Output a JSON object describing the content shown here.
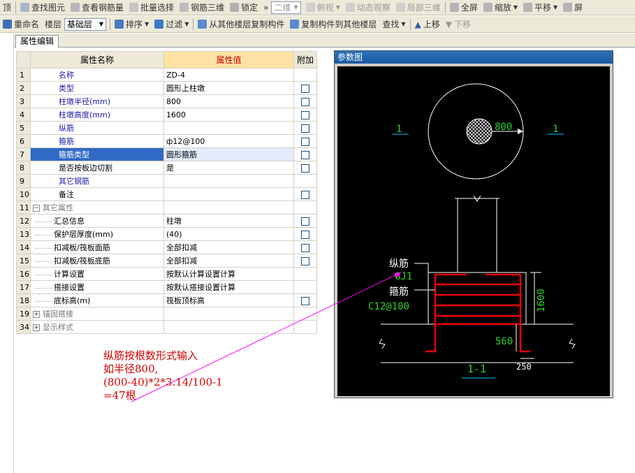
{
  "toolbar1": {
    "items": [
      "顶",
      "查找图元",
      "查看钢筋量",
      "批量选择",
      "钢筋三维",
      "锁定"
    ],
    "overflow": "»",
    "view_mode": "二维",
    "items2": [
      "俯视",
      "动态观察",
      "局部三维",
      "全屏",
      "缩放",
      "平移",
      "屏"
    ]
  },
  "toolbar2": {
    "rename": "重命名",
    "floor_label": "楼层",
    "floor_value": "基础层",
    "sort": "排序",
    "filter": "过滤",
    "copy_from": "从其他楼层复制构件",
    "copy_to": "复制构件到其他楼层",
    "find": "查找",
    "move_up": "上移",
    "move_down": "下移"
  },
  "tab": "属性编辑",
  "grid": {
    "headers": {
      "name": "属性名称",
      "value": "属性值",
      "extra": "附加"
    },
    "rows": [
      {
        "num": "1",
        "name": "名称",
        "value": "ZD-4",
        "blue": true,
        "cb": false,
        "tree": "",
        "indent": false
      },
      {
        "num": "2",
        "name": "类型",
        "value": "圆形上柱墩",
        "blue": true,
        "cb": true,
        "tree": "",
        "indent": false
      },
      {
        "num": "3",
        "name": "柱墩半径(mm)",
        "value": "800",
        "blue": true,
        "cb": true,
        "tree": "",
        "indent": false
      },
      {
        "num": "4",
        "name": "柱墩高度(mm)",
        "value": "1600",
        "blue": true,
        "cb": true,
        "tree": "",
        "indent": false
      },
      {
        "num": "5",
        "name": "纵筋",
        "value": "",
        "blue": true,
        "cb": true,
        "tree": "",
        "indent": false
      },
      {
        "num": "6",
        "name": "箍筋",
        "value": "ф12@100",
        "blue": true,
        "cb": true,
        "tree": "",
        "indent": false
      },
      {
        "num": "7",
        "name": "箍筋类型",
        "value": "圆形箍筋",
        "blue": true,
        "cb": true,
        "tree": "",
        "indent": false,
        "selected": true
      },
      {
        "num": "8",
        "name": "是否按板边切割",
        "value": "是",
        "blue": false,
        "cb": true,
        "tree": "",
        "indent": false
      },
      {
        "num": "9",
        "name": "其它钢筋",
        "value": "",
        "blue": true,
        "cb": false,
        "tree": "",
        "indent": false
      },
      {
        "num": "10",
        "name": "备注",
        "value": "",
        "blue": false,
        "cb": true,
        "tree": "",
        "indent": false
      },
      {
        "num": "11",
        "name": "其它属性",
        "value": "",
        "blue": false,
        "cb": false,
        "tree": "−",
        "indent": false,
        "group": true
      },
      {
        "num": "12",
        "name": "汇总信息",
        "value": "柱墩",
        "blue": false,
        "cb": true,
        "tree": "",
        "indent": true
      },
      {
        "num": "13",
        "name": "保护层厚度(mm)",
        "value": "(40)",
        "blue": false,
        "cb": true,
        "tree": "",
        "indent": true
      },
      {
        "num": "14",
        "name": "扣减板/筏板面筋",
        "value": "全部扣减",
        "blue": false,
        "cb": true,
        "tree": "",
        "indent": true
      },
      {
        "num": "15",
        "name": "扣减板/筏板底筋",
        "value": "全部扣减",
        "blue": false,
        "cb": true,
        "tree": "",
        "indent": true
      },
      {
        "num": "16",
        "name": "计算设置",
        "value": "按默认计算设置计算",
        "blue": false,
        "cb": false,
        "tree": "",
        "indent": true
      },
      {
        "num": "17",
        "name": "搭接设置",
        "value": "按默认搭接设置计算",
        "blue": false,
        "cb": false,
        "tree": "",
        "indent": true
      },
      {
        "num": "18",
        "name": "底标高(m)",
        "value": "筏板顶标高",
        "blue": false,
        "cb": true,
        "tree": "",
        "indent": true
      },
      {
        "num": "19",
        "name": "锚固搭接",
        "value": "",
        "blue": false,
        "cb": false,
        "tree": "+",
        "indent": false,
        "group": true
      },
      {
        "num": "34",
        "name": "显示样式",
        "value": "",
        "blue": false,
        "cb": false,
        "tree": "+",
        "indent": false,
        "group": true
      }
    ]
  },
  "panel": {
    "title": "参数图",
    "drawing": {
      "radius_dim": "800",
      "section_mark": "1",
      "label_long_bar": "纵筋",
      "label_gj": "GJ1",
      "label_stirrup": "箍筋",
      "label_spec": "C12@100",
      "dim_height": "1600",
      "dim_560": "560",
      "dim_250": "250",
      "section_title": "1-1"
    }
  },
  "annotation": {
    "lines": [
      "纵筋按根数形式输入",
      "如半径800,",
      "(800-40)*2*3.14/100-1",
      "=47根"
    ],
    "color": "#d40000"
  }
}
